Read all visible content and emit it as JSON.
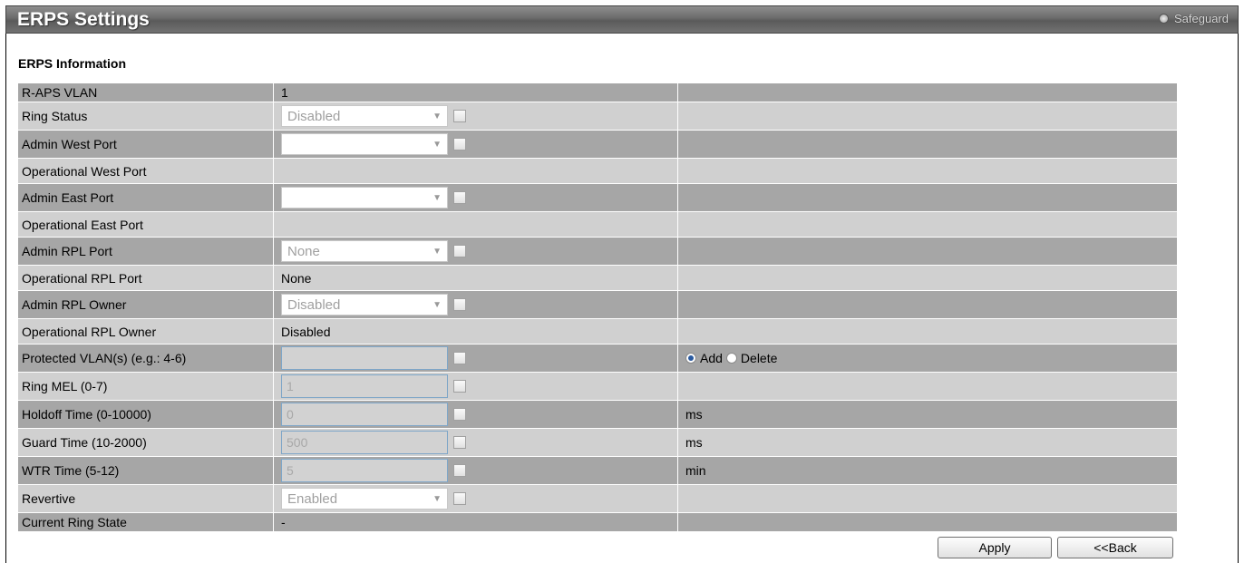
{
  "header": {
    "title": "ERPS Settings",
    "safeguard_label": "Safeguard"
  },
  "section": {
    "title": "ERPS Information"
  },
  "rows": [
    {
      "label": "R-APS VLAN",
      "value": "1"
    },
    {
      "label": "Ring Status",
      "select": "Disabled"
    },
    {
      "label": "Admin West Port",
      "select": ""
    },
    {
      "label": "Operational West Port",
      "value": ""
    },
    {
      "label": "Admin East Port",
      "select": ""
    },
    {
      "label": "Operational East Port",
      "value": ""
    },
    {
      "label": "Admin RPL Port",
      "select": "None"
    },
    {
      "label": "Operational RPL Port",
      "value": "None"
    },
    {
      "label": "Admin RPL Owner",
      "select": "Disabled"
    },
    {
      "label": "Operational RPL Owner",
      "value": "Disabled"
    },
    {
      "label": "Protected VLAN(s) (e.g.: 4-6)",
      "input": ""
    },
    {
      "label": "Ring MEL (0-7)",
      "input": "1"
    },
    {
      "label": "Holdoff Time (0-10000)",
      "input": "0",
      "unit": "ms"
    },
    {
      "label": "Guard Time (10-2000)",
      "input": "500",
      "unit": "ms"
    },
    {
      "label": "WTR Time (5-12)",
      "input": "5",
      "unit": "min"
    },
    {
      "label": "Revertive",
      "select": "Enabled"
    },
    {
      "label": "Current Ring State",
      "value": "-"
    }
  ],
  "radio": {
    "add": "Add",
    "delete": "Delete",
    "selected": "Add"
  },
  "buttons": {
    "apply": "Apply",
    "back": "<<Back"
  }
}
